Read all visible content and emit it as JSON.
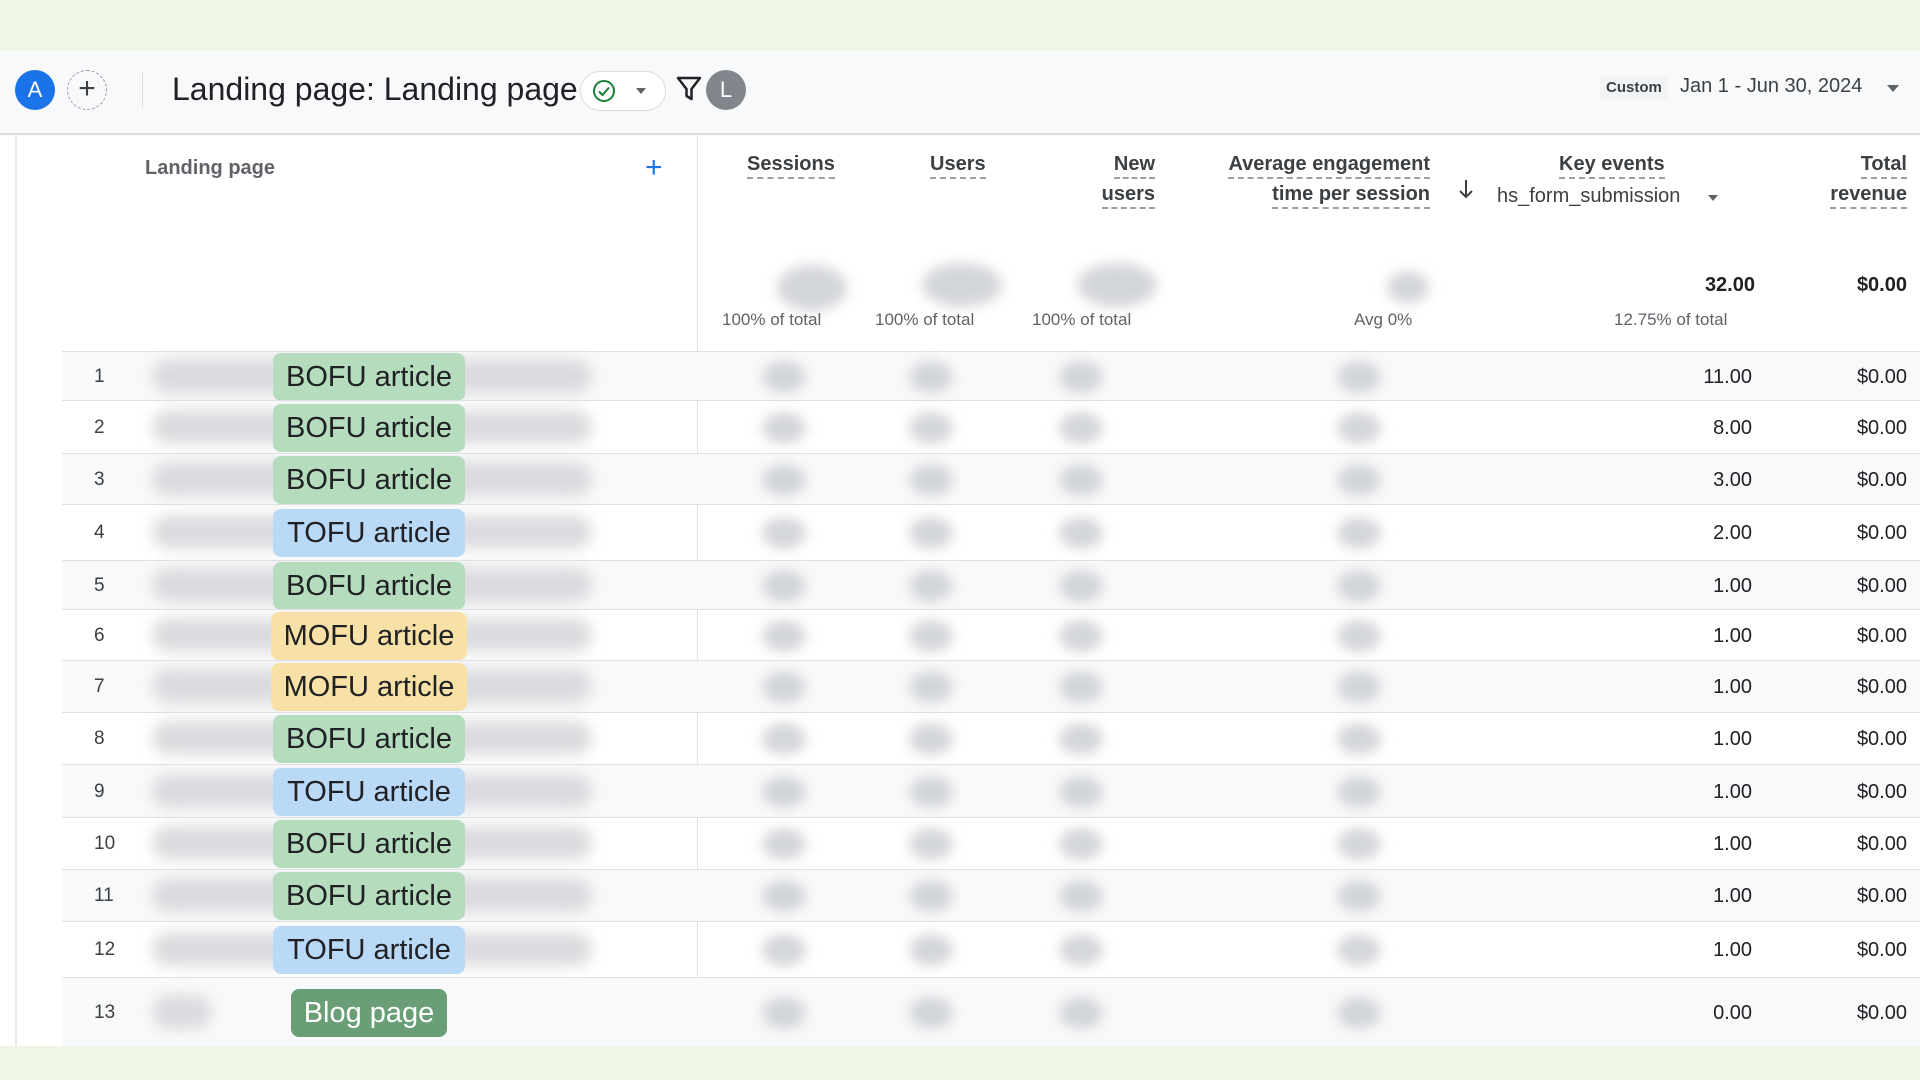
{
  "header": {
    "avatar_initial": "A",
    "add_label": "+",
    "report_title": "Landing page: Landing page",
    "user_initial": "L",
    "date_chip": "Custom",
    "date_range": "Jan 1 - Jun 30, 2024"
  },
  "table": {
    "dimension_header": "Landing page",
    "add_dimension": "+",
    "columns": {
      "sessions": "Sessions",
      "users": "Users",
      "new_users_1": "New",
      "new_users_2": "users",
      "avg_eng_1": "Average engagement",
      "avg_eng_2": "time per session",
      "key_events": "Key events",
      "key_event_name": "hs_form_submission",
      "revenue_1": "Total",
      "revenue_2": "revenue"
    },
    "totals": {
      "sessions_pct": "100% of total",
      "users_pct": "100% of total",
      "new_users_pct": "100% of total",
      "avg_eng": "Avg 0%",
      "key_events": "32.00",
      "key_events_pct": "12.75% of total",
      "revenue": "$0.00"
    },
    "rows": [
      {
        "n": "1",
        "tag": "BOFU article",
        "kind": "bofu",
        "key_events": "11.00",
        "revenue": "$0.00"
      },
      {
        "n": "2",
        "tag": "BOFU article",
        "kind": "bofu",
        "key_events": "8.00",
        "revenue": "$0.00"
      },
      {
        "n": "3",
        "tag": "BOFU article",
        "kind": "bofu",
        "key_events": "3.00",
        "revenue": "$0.00"
      },
      {
        "n": "4",
        "tag": "TOFU article",
        "kind": "tofu",
        "key_events": "2.00",
        "revenue": "$0.00"
      },
      {
        "n": "5",
        "tag": "BOFU article",
        "kind": "bofu",
        "key_events": "1.00",
        "revenue": "$0.00"
      },
      {
        "n": "6",
        "tag": "MOFU article",
        "kind": "mofu",
        "key_events": "1.00",
        "revenue": "$0.00"
      },
      {
        "n": "7",
        "tag": "MOFU article",
        "kind": "mofu",
        "key_events": "1.00",
        "revenue": "$0.00"
      },
      {
        "n": "8",
        "tag": "BOFU article",
        "kind": "bofu",
        "key_events": "1.00",
        "revenue": "$0.00"
      },
      {
        "n": "9",
        "tag": "TOFU article",
        "kind": "tofu",
        "key_events": "1.00",
        "revenue": "$0.00"
      },
      {
        "n": "10",
        "tag": "BOFU article",
        "kind": "bofu",
        "key_events": "1.00",
        "revenue": "$0.00"
      },
      {
        "n": "11",
        "tag": "BOFU article",
        "kind": "bofu",
        "key_events": "1.00",
        "revenue": "$0.00"
      },
      {
        "n": "12",
        "tag": "TOFU article",
        "kind": "tofu",
        "key_events": "1.00",
        "revenue": "$0.00"
      },
      {
        "n": "13",
        "tag": "Blog page",
        "kind": "blog",
        "key_events": "0.00",
        "revenue": "$0.00"
      }
    ]
  },
  "colors": {
    "accent": "#1a73e8",
    "bofu": "#b5dcbd",
    "tofu": "#b9d9f7",
    "mofu": "#f8e1a6",
    "blog": "#6a9e76",
    "status_ok": "#188038"
  }
}
